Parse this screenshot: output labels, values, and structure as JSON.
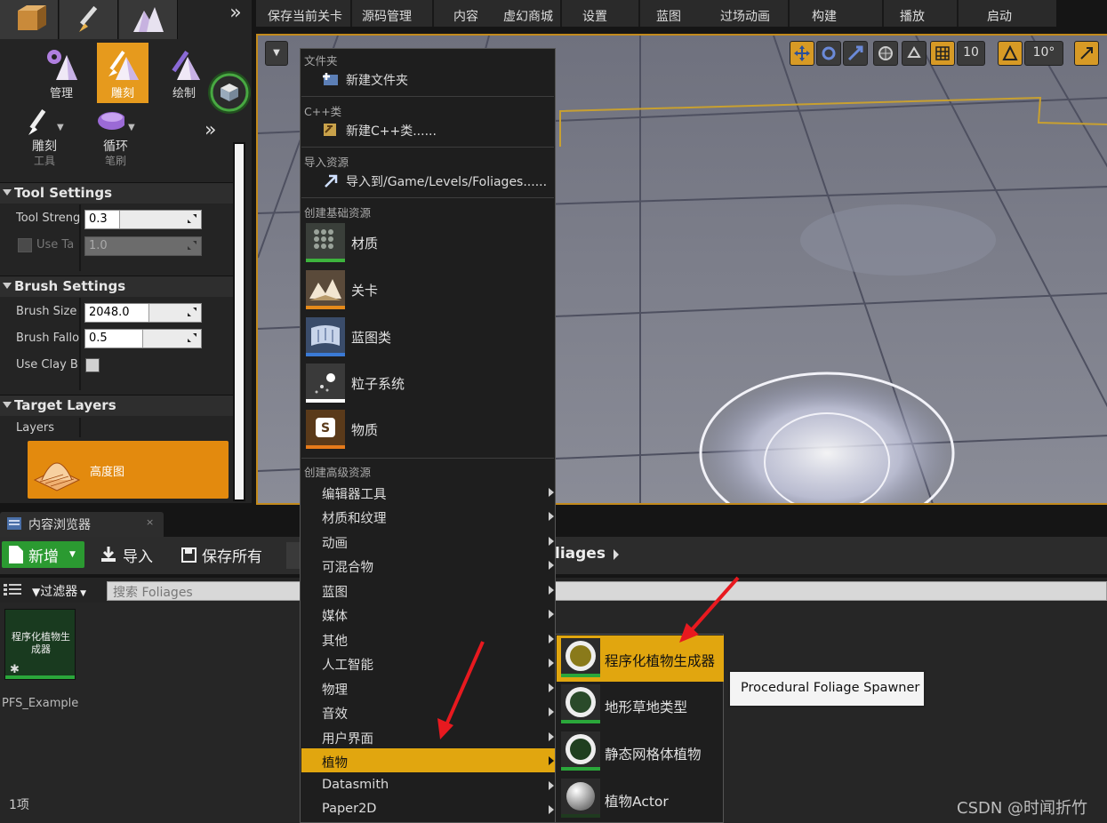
{
  "modes_panel": {
    "modes": [
      {
        "label": "管理",
        "icon": "foliage-manage-icon"
      },
      {
        "label": "雕刻",
        "icon": "sculpt-brush-icon",
        "active": true
      },
      {
        "label": "绘制",
        "icon": "paint-brush-icon"
      }
    ],
    "tools": [
      {
        "label": "雕刻",
        "sublabel": "工具",
        "icon": "sculpt-tool-icon"
      },
      {
        "label": "循环",
        "sublabel": "笔刷",
        "icon": "circle-brush-icon"
      }
    ],
    "tool_settings": {
      "title": "Tool Settings",
      "tool_strength_label": "Tool Streng",
      "tool_strength_value": "0.3",
      "tool_strength_fill": 0.3,
      "use_target_label": "Use Ta",
      "use_target_value": "1.0"
    },
    "brush_settings": {
      "title": "Brush Settings",
      "brush_size_label": "Brush Size",
      "brush_size_value": "2048.0",
      "brush_size_fill": 0.55,
      "brush_falloff_label": "Brush Fallo",
      "brush_falloff_value": "0.5",
      "brush_falloff_fill": 0.5,
      "use_clay_label": "Use Clay B"
    },
    "target_layers": {
      "title": "Target Layers",
      "layers_label": "Layers",
      "layer_name": "高度图"
    }
  },
  "toolbar": {
    "items": [
      "保存当前关卡",
      "源码管理",
      "内容",
      "虚幻商城",
      "设置",
      "蓝图",
      "过场动画",
      "构建",
      "播放",
      "启动"
    ]
  },
  "viewport": {
    "grid_snap_value": "10",
    "rotation_snap_value": "10°"
  },
  "content_browser": {
    "tab_title": "内容浏览器",
    "new_button": "新增",
    "import_button": "导入",
    "save_all_button": "保存所有",
    "path_partial": "liages",
    "filters_label": "过滤器",
    "search_placeholder": "搜索 Foliages",
    "asset_tile_label": "程序化植物生成器",
    "asset_name": "PFS_Example",
    "item_count": "1项"
  },
  "context_menu": {
    "folder_header": "文件夹",
    "new_folder": "新建文件夹",
    "cpp_header": "C++类",
    "new_cpp": "新建C++类......",
    "import_header": "导入资源",
    "import_to": "导入到/Game/Levels/Foliages......",
    "basic_header": "创建基础资源",
    "basic_assets": [
      {
        "label": "材质",
        "icon": "material-icon",
        "color": "#3db33d"
      },
      {
        "label": "关卡",
        "icon": "level-icon",
        "color": "#e68a1a"
      },
      {
        "label": "蓝图类",
        "icon": "blueprint-class-icon",
        "color": "#3a7ad6"
      },
      {
        "label": "粒子系统",
        "icon": "particle-system-icon",
        "color": "#ffffff"
      },
      {
        "label": "物质",
        "icon": "substance-icon",
        "color": "#e67a1a"
      }
    ],
    "advanced_header": "创建高级资源",
    "advanced_items": [
      "编辑器工具",
      "材质和纹理",
      "动画",
      "可混合物",
      "蓝图",
      "媒体",
      "其他",
      "人工智能",
      "物理",
      "音效",
      "用户界面",
      "植物",
      "Datasmith",
      "Paper2D"
    ],
    "highlighted_item": "植物"
  },
  "submenu": {
    "items": [
      {
        "label": "程序化植物生成器",
        "icon": "procedural-foliage-spawner-icon",
        "highlighted": true
      },
      {
        "label": "地形草地类型",
        "icon": "landscape-grass-type-icon"
      },
      {
        "label": "静态网格体植物",
        "icon": "static-mesh-foliage-icon"
      },
      {
        "label": "植物Actor",
        "icon": "foliage-actor-icon"
      }
    ]
  },
  "tooltip": "Procedural Foliage Spawner",
  "watermark": "CSDN @时闻折竹"
}
